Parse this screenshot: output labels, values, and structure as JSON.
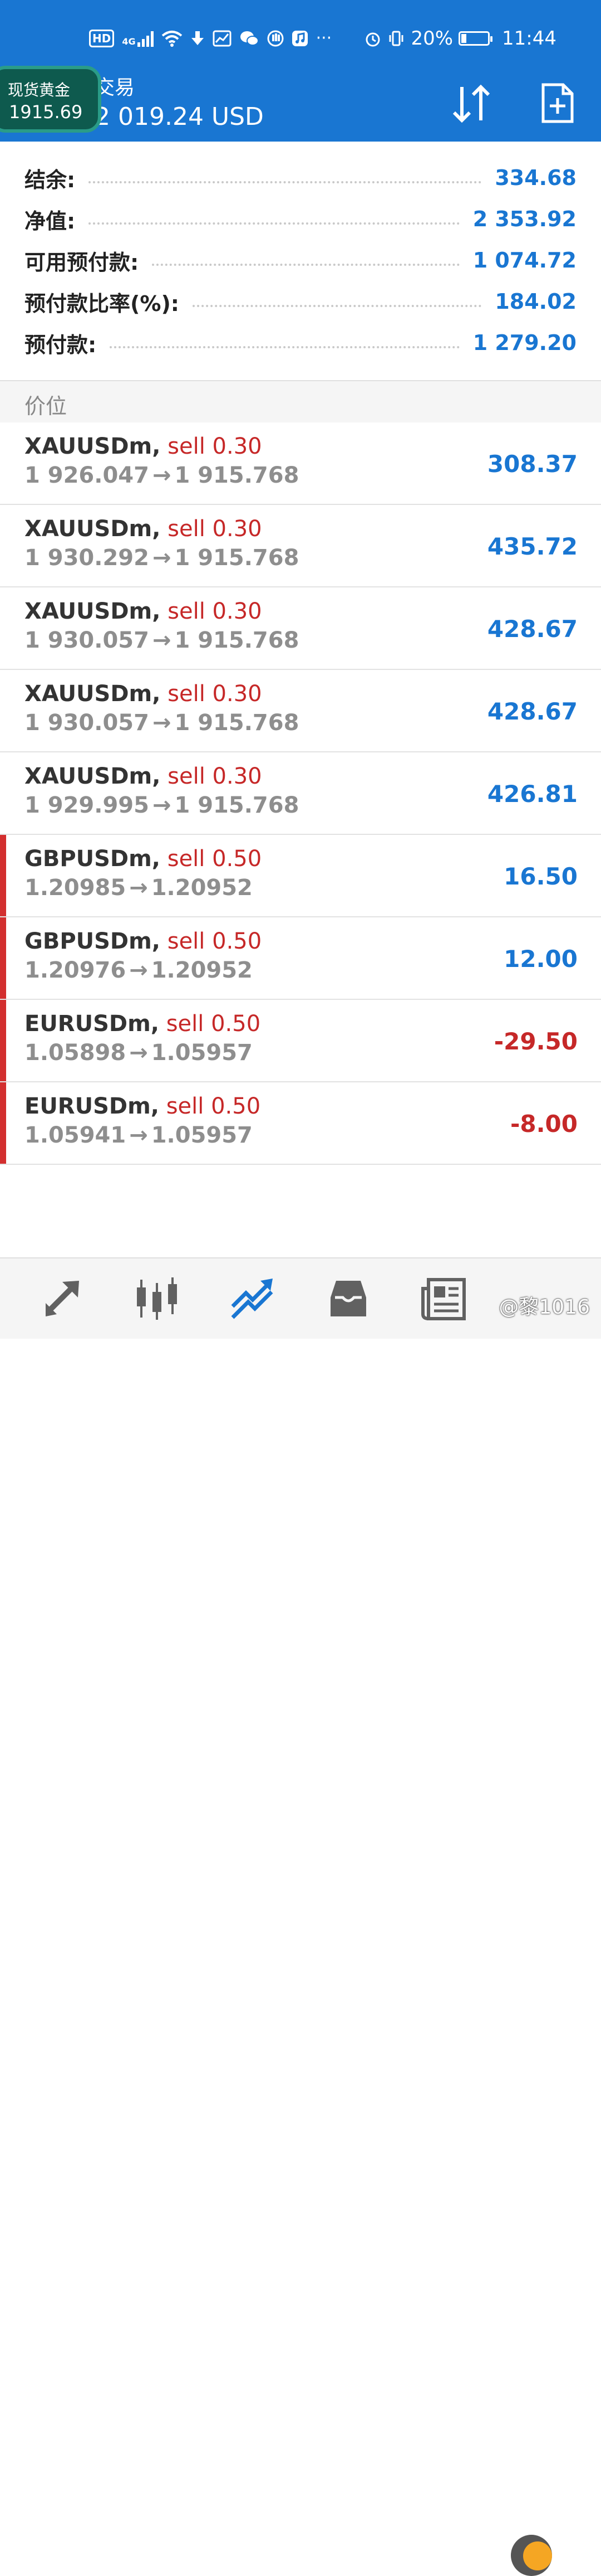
{
  "status_bar": {
    "left_icons": [
      "hd-icon",
      "4g-signal-icon",
      "wifi-icon",
      "download-icon",
      "chart-app-icon",
      "wechat-icon",
      "hand-icon",
      "music-icon"
    ],
    "hd_label": "HD",
    "net_label": "4G",
    "more": "···",
    "battery": "20%",
    "battery_level": 0.2,
    "time": "11:44"
  },
  "header": {
    "title": "交易",
    "balance_line": "2 019.24 USD"
  },
  "float_widget": {
    "label": "现货黄金",
    "price": "1915.69"
  },
  "summary": [
    {
      "label": "结余:",
      "value": "334.68"
    },
    {
      "label": "净值:",
      "value": "2 353.92"
    },
    {
      "label": "可用预付款:",
      "value": "1 074.72"
    },
    {
      "label": "预付款比率(%):",
      "value": "184.02"
    },
    {
      "label": "预付款:",
      "value": "1 279.20"
    }
  ],
  "section_title": "价位",
  "orders": [
    {
      "symbol": "XAUUSDm,",
      "side": "sell 0.30",
      "open": "1 926.047",
      "arrow": "→",
      "current": "1 915.768",
      "profit": "308.37",
      "sign": "pos",
      "marked": false
    },
    {
      "symbol": "XAUUSDm,",
      "side": "sell 0.30",
      "open": "1 930.292",
      "arrow": "→",
      "current": "1 915.768",
      "profit": "435.72",
      "sign": "pos",
      "marked": false
    },
    {
      "symbol": "XAUUSDm,",
      "side": "sell 0.30",
      "open": "1 930.057",
      "arrow": "→",
      "current": "1 915.768",
      "profit": "428.67",
      "sign": "pos",
      "marked": false
    },
    {
      "symbol": "XAUUSDm,",
      "side": "sell 0.30",
      "open": "1 930.057",
      "arrow": "→",
      "current": "1 915.768",
      "profit": "428.67",
      "sign": "pos",
      "marked": false
    },
    {
      "symbol": "XAUUSDm,",
      "side": "sell 0.30",
      "open": "1 929.995",
      "arrow": "→",
      "current": "1 915.768",
      "profit": "426.81",
      "sign": "pos",
      "marked": false
    },
    {
      "symbol": "GBPUSDm,",
      "side": "sell 0.50",
      "open": "1.20985",
      "arrow": "→",
      "current": "1.20952",
      "profit": "16.50",
      "sign": "pos",
      "marked": true
    },
    {
      "symbol": "GBPUSDm,",
      "side": "sell 0.50",
      "open": "1.20976",
      "arrow": "→",
      "current": "1.20952",
      "profit": "12.00",
      "sign": "pos",
      "marked": true
    },
    {
      "symbol": "EURUSDm,",
      "side": "sell 0.50",
      "open": "1.05898",
      "arrow": "→",
      "current": "1.05957",
      "profit": "-29.50",
      "sign": "neg",
      "marked": true
    },
    {
      "symbol": "EURUSDm,",
      "side": "sell 0.50",
      "open": "1.05941",
      "arrow": "→",
      "current": "1.05957",
      "profit": "-8.00",
      "sign": "neg",
      "marked": true
    }
  ],
  "bottom_nav": [
    {
      "name": "quotes-icon",
      "active": false
    },
    {
      "name": "chart-icon",
      "active": false
    },
    {
      "name": "trade-icon",
      "active": true
    },
    {
      "name": "history-icon",
      "active": false
    },
    {
      "name": "news-icon",
      "active": false
    },
    {
      "name": "settings-icon",
      "active": false
    }
  ],
  "watermark": "@黎1016",
  "colors": {
    "appbar": "#1976d2",
    "positive": "#1976d2",
    "negative": "#c62828",
    "sell": "#c62828"
  }
}
